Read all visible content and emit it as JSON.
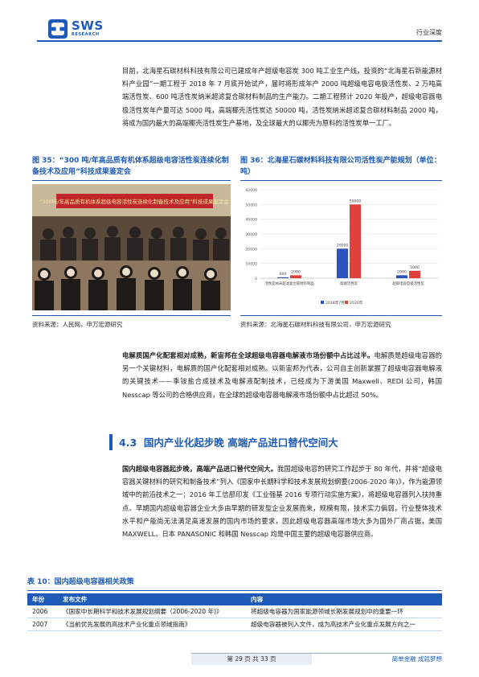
{
  "header": {
    "logo_text": "SWS",
    "logo_sub": "RESEARCH",
    "tag": "行业深度"
  },
  "intro_paragraph": "目前，北海星石碳材料科技有限公司已建成年产超级电容炭 300 吨工业生产线，投资的“北海星石新能源材料产业园”一期工程于 2018 年 7 月底开始试产，届时将形成年产 2000 吨超级电容电极活性炭、2 万吨高端活性炭、600 吨活性炭纳米超滤复合碳材料制品的生产能力。二期工程预计 2020 年投产，超级电容器电极活性炭年产量可达 5000 吨，高端椰壳活性炭达 50000 吨，活性炭纳米超滤复合碳材料制品 2000 吨，将成为国内最大的高端椰壳活性炭生产基地，及全球最大的以椰壳为原料的活性炭单一工厂。",
  "figure35": {
    "title": "图 35：“300 吨/年高品质有机体系超级电容活性炭连续化制备技术及应用”科技成果鉴定会",
    "banner": "“300吨/年高品质有机体系超级电容活性炭连续化制备技术及应用”科技成果鉴定会",
    "source": "资料来源：人民网，申万宏源研究"
  },
  "figure36": {
    "title": "图 36：北海星石碳材料科技有限公司活性炭产能规划（单位：吨）",
    "source": "资料来源：北海星石碳材料科技有限公司，申万宏源研究"
  },
  "chart_data": {
    "type": "bar",
    "title": "",
    "xlabel": "",
    "ylabel": "",
    "ylim": [
      0,
      60000
    ],
    "yticks": [
      "60000",
      "50000",
      "40000",
      "30000",
      "20000",
      "10000",
      "0"
    ],
    "categories": [
      "活性炭纳米超滤复合碳材料制品",
      "高端活性炭",
      "超级电容电极活性炭"
    ],
    "series": [
      {
        "name": "2018年7月",
        "color": "#2a52be",
        "values": [
          600,
          20000,
          2000
        ],
        "labels": [
          "600",
          "20000",
          "2000"
        ]
      },
      {
        "name": "2020年",
        "color": "#e0413a",
        "values": [
          2000,
          50000,
          5000
        ],
        "labels": [
          "2000",
          "50000",
          "5000"
        ]
      }
    ],
    "legend": "bottom"
  },
  "electrolyte": {
    "lead": "电解质国产化配套相对成熟，新宙邦在全球超级电容器电解液市场份额中占比过半。",
    "body": "电解质是超级电容器的另一个关键材料，电解质的国产化配套相对成熟。以新宙邦为代表，公司自主创新掌握了超级电容器电解液的关键技术——季铵盐合成技术及电解液配制技术，已经成为下游美国 Maxwell、REDI 公司，韩国 Nesscap 等公司的合格供应商，在全球的超级电容器电解液市场份额中占比超过 50%。"
  },
  "section": {
    "number": "4.3",
    "title": "国内产业化起步晚 高端产品进口替代空间大"
  },
  "domestic": {
    "lead": "国内超级电容器起步晚，高端产品进口替代空间大。",
    "body": "我国超级电容的研究工作起步于 80 年代，并将“超级电容器关键材料的研究和制备技术”列入《国家中长期科学和技术发展规划纲要(2006-2020 年)》，作为能源领域中的前沿技术之一；2016 年工信部印发《工业强基 2016 专项行动实施方案》，将超级电容器列入扶持重点。早期国内超级电容器企业大多由早期的研发型企业发展而来，规模有限，技术实力偏弱，行业整体技术水平和产能尚无法满足高速发展的国内市场的要求，因此超级电容器高端市场大多为国外厂商占据，美国 MAXWELL、日本 PANASONIC 和韩国 Nesscap 均是中国主要的超级电容器供应商。"
  },
  "table10": {
    "title": "表 10：国内超级电容器相关政策",
    "headers": [
      "年份",
      "发布文件",
      "内容"
    ],
    "rows": [
      [
        "2006",
        "《国家中长期科学和技术发展规划纲要（2006-2020 年)》",
        "将超级电容器为国家能源领域长期发展规划中的重要一环"
      ],
      [
        "2007",
        "《当前优先发展的高技术产业化重点领域指南》",
        "超级电容器被列入文件，成为高技术产业化重点发展方向之一"
      ]
    ]
  },
  "footer": {
    "page": "第 29 页 共 33 页",
    "slogan": "简单金融 成就梦想"
  }
}
